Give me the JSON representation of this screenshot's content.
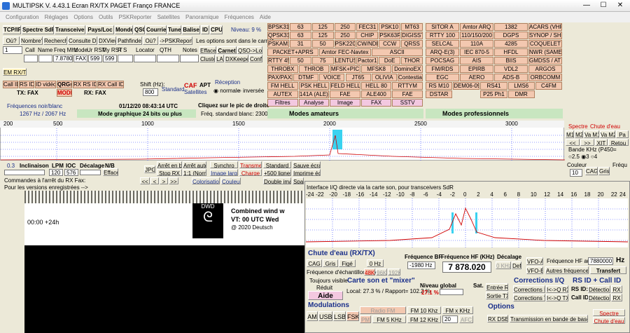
{
  "window": {
    "title": "MULTIPSK V. 4.43.1   Ecran RX/TX  PAGET Franço                                    FRANCE",
    "btn_min": "—",
    "btn_max": "☐",
    "btn_close": "✕"
  },
  "menu": [
    "Configuration",
    "Réglages",
    "Options",
    "Outils",
    "PSKReporter",
    "Satellites",
    "Panoramique",
    "Fréquences",
    "Aide"
  ],
  "toolbar": [
    "TCP/IP",
    "Spectre SdR",
    "Transceiver",
    "Pays/Loc",
    "Monde",
    "QSO",
    "Courrier",
    "Tune",
    "Balise",
    "ID",
    "CPU"
  ],
  "niveau": "Niveau: 9 %",
  "row2": [
    "Où?",
    "Nombre?",
    "Recherche",
    "Consulte DXC",
    "DXView",
    "Pathfinder",
    "Où?",
    "->PSKReporter",
    "Les options sont dans le carnet"
  ],
  "log": {
    "headers": [
      "Call",
      "Name",
      "Freq Mhz",
      "Mode",
      "Ur RST",
      "My RST",
      "R",
      "S",
      "Locator",
      "QTH",
      "Notes"
    ],
    "idx": "1",
    "freq": "7.878020",
    "mode": "FAX",
    "ur_rst": "599",
    "my_rst": "599",
    "effacer": "Effacer",
    "carnet": "Carnet",
    "qso_log": "QSO->Log",
    "cluster": "Cluster",
    "la": "LA",
    "dxkeeper": "DXKeeper",
    "conf": "Conf"
  },
  "em_rxtx": "EM RX/TX",
  "mode_row": {
    "call_id": "Call ID",
    "rs_id": "RS ID",
    "id_video": "ID vidéo",
    "qrgs": "QRGs",
    "mode": "MODE",
    "rx_rs_id": "RX RS ID",
    "rx_call_id": "RX Call ID",
    "tx_fax": "TX: FAX",
    "rx_fax": "RX: FAX",
    "shift_lbl": "Shift (Hz):",
    "shift_val": "800",
    "standard": "Standard",
    "caf": "CAF",
    "satellites": "Satellites",
    "apt": "APT",
    "reception": "Réception",
    "normale": "normale",
    "inversee": "inversée"
  },
  "freq_row": {
    "label": "Fréquences noir/blanc",
    "value": "1267 Hz / 2067 Hz",
    "date": "01/12/20 08:43:14 UTC",
    "graph": "Mode graphique 24 bits ou plus",
    "click": "Cliquez sur le pic de droite",
    "std": "Fréq. standard blanc: 2300 Hz"
  },
  "mode_buttons": [
    [
      "BPSK31",
      "63",
      "125",
      "250",
      "FEC31",
      "PSK10",
      "MT63"
    ],
    [
      "QPSK31",
      "63",
      "125",
      "250",
      "CHIP",
      "PSK63F",
      "DIGISSTV"
    ],
    [
      "PSKAM10",
      "31",
      "50",
      "PSK220F",
      "CW/NDB",
      "CCW",
      "QRSS"
    ],
    [
      "PACKET+APRS",
      "Amtor FEC-Navtex",
      "ASCII"
    ],
    [
      "RTTY 45",
      "50",
      "75",
      "LENTUS",
      "Pactor1",
      "DoE",
      "THOR"
    ],
    [
      "THROBX",
      "THROB",
      "MFSK+PIC",
      "MFSK8",
      "DominoEX"
    ],
    [
      "PAX/PAX2",
      "DTMF",
      "VOICE",
      "JT65",
      "OLIVIA",
      "Contestia"
    ],
    [
      "FM HELL",
      "PSK HELL",
      "FELD HELL",
      "HELL 80",
      "RTTYM"
    ],
    [
      "AUTEX",
      "141A (ALE)",
      "FAE",
      "ALE400",
      "FAE"
    ],
    [
      "Filtres",
      "Analyse",
      "Image",
      "FAX",
      "SSTV"
    ]
  ],
  "pro_buttons": [
    [
      "SITOR A",
      "Amtor ARQ",
      "1382",
      "ACARS (VHF)"
    ],
    [
      "RTTY 100",
      "110/150/200",
      "DGPS",
      "SYNOP / SHIP"
    ],
    [
      "SELCAL",
      "110A",
      "4285",
      "COQUELET"
    ],
    [
      "ARQ-E(3)",
      "IEC 870-5",
      "HFDL",
      "NWR (SAME)"
    ],
    [
      "POCSAG",
      "AIS",
      "BIIS",
      "GMDSS / ATIS"
    ],
    [
      "FM/RDS",
      "EPIRB",
      "VDL2",
      "ARGOS"
    ],
    [
      "EGC",
      "AERO",
      "ADS-B",
      "ORBCOMM"
    ],
    [
      "RS M10",
      "DEM06-09",
      "RS41",
      "LMS6",
      "C4FM"
    ],
    [
      "DSTAR",
      "",
      "P25 Ph1",
      "DMR",
      ""
    ]
  ],
  "modes_amateurs": "Modes amateurs",
  "modes_pro": "Modes professionnels",
  "scale_ticks": [
    "200",
    "500",
    "1000",
    "1500",
    "2000",
    "2500",
    "3000"
  ],
  "right_panel": {
    "spectre": "Spectre",
    "chute": "Chute d'eau",
    "m1": "M1",
    "m2": "M2",
    "vam1": "Va M1",
    "vam2": "Va M2",
    "pa": "Pa",
    "xit": "XIT",
    "retour": "Retou",
    "bande": "Bande KHz (P450=",
    "b25": "2.5",
    "b3": "3",
    "b4": "4",
    "couleur": "Couleur",
    "couleur_val": "10",
    "cag": "CAG",
    "gris": "Gris",
    "frequ": "Fréqu"
  },
  "waterfall_ctrl": {
    "v03": "0.3",
    "inclinaison": "Inclinaison",
    "lpm": "LPM",
    "ioc": "IOC",
    "decalage": "Décalage",
    "nb": "N/B",
    "lpm_val": "120",
    "ioc_val": "576",
    "effacer": "Effacer",
    "jpg": "JPG",
    "arret_bas": "Arrêt en bas",
    "arret_auto": "Arrêt auto",
    "synchro": "Synchro",
    "transmet": "Transmet",
    "standard": "Standard",
    "sauve": "Sauve écran",
    "stop_rx": "Stop RX",
    "normal": "1:1 (Normal)",
    "image_large": "Image large",
    "charge": "Charge",
    "lignes": "+500 lignes",
    "imprime": "Imprime écran",
    "cmd_fax": "Commandes à l'arrêt du RX Fax:",
    "versions": "Pour les versions enregistrées -->",
    "colorisation": "Colorisation",
    "couleurs": "Couleurs",
    "double": "Double image",
    "spare": "Spare"
  },
  "fax_image": {
    "logo": "DWD",
    "line1": "Combined wind w",
    "line2": "VT: 00 UTC Wed",
    "line3": "@ 2020 Deutsch",
    "hdr": "00:00 +24h"
  },
  "iq": {
    "title": "Interface I/Q directe via la carte son, pour transceivers SdR",
    "ticks": [
      "-24",
      "-22",
      "-20",
      "-18",
      "-16",
      "-14",
      "-12",
      "-10",
      "-8",
      "-6",
      "-4",
      "-2",
      "0",
      "2",
      "4",
      "6",
      "8",
      "10",
      "12",
      "14",
      "16",
      "18",
      "20",
      "22",
      "24"
    ],
    "chute_title": "Chute d'eau (RX/TX)",
    "cag": "CAG",
    "gris": "Gris",
    "fige": "Figé",
    "zero_hz": "0 Hz",
    "decalage": "Décalage",
    "echant_lbl": "Fréquence d'échantillonnage",
    "k48": "48K",
    "k96": "96K",
    "k192": "192K",
    "freq_bf_lbl": "Fréquence BF",
    "freq_bf": "-1980 Hz",
    "freq_hf_lbl": "Fréquence HF (KHz)",
    "freq_hf": "7 878.020",
    "zero_khz": "0 KHz",
    "def": "Def",
    "vfo_a": "VFO-A",
    "vfo_b": "VFO-B",
    "hf_au0_lbl": "Fréquence HF au 0",
    "hf_au0": "7880000",
    "hz": "Hz",
    "autres": "Autres fréquences",
    "transfert": "Transfert",
    "toujours": "Toujours visible",
    "reduit": "Réduit",
    "aide": "Aide",
    "carte_title": "Carte son et \"mixer\"",
    "local": "Local:",
    "local_val": "27.3 %",
    "rapport": "/ Rapport=",
    "rapport_val": "102.2 %",
    "niveau": "Niveau global",
    "niveau_val": "27.1 %",
    "sat": "Sat.",
    "entree_rx": "Entrée RX",
    "sortie_tx": "Sortie TX",
    "corr_title": "Corrections I/Q",
    "corr_rx": "Corrections RX",
    "corr_tx": "Corrections TX",
    "qrx": "I<->Q RX",
    "qtx": "I<->Q TX",
    "rsid_title": "RS ID + Call ID",
    "rsid": "RS ID:",
    "callid": "Call ID:",
    "detection": "Détection",
    "rx": "RX",
    "modul_title": "Modulations",
    "am": "AM",
    "usb": "USB",
    "lsb": "LSB",
    "fsk": "FSK",
    "radio_fm": "Radio FM",
    "fm10": "FM 10 Khz",
    "fmx": "FM x KHz",
    "pm": "PM",
    "fm5": "FM 5 KHz",
    "fm12": "FM 12 KHz",
    "fmx_val": "20",
    "afc": "AFC",
    "options_title": "Options",
    "rx_dsb": "RX DSB",
    "transmission": "Transmission en bande de base",
    "spectre": "Spectre",
    "chute": "Chute d'eau"
  }
}
